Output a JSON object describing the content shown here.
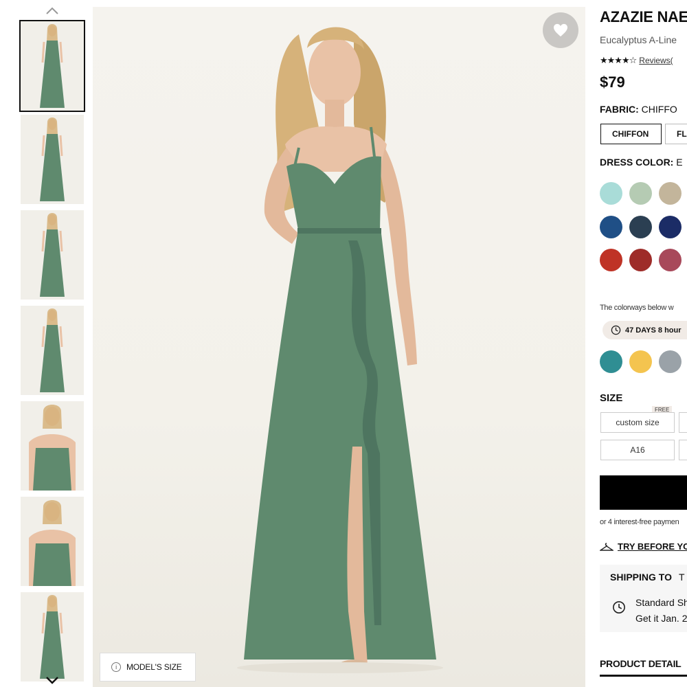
{
  "thumbnails": [
    {
      "view": "front",
      "selected": true
    },
    {
      "view": "back",
      "selected": false
    },
    {
      "view": "front-step",
      "selected": false
    },
    {
      "view": "back-full",
      "selected": false
    },
    {
      "view": "closeup-front",
      "selected": false
    },
    {
      "view": "closeup-back",
      "selected": false
    },
    {
      "view": "front-walk",
      "selected": false
    }
  ],
  "gallery": {
    "prev_icon": "chevron-up-icon",
    "next_icon": "chevron-down-icon",
    "favorite_icon": "heart-icon",
    "model_size_label": "MODEL'S SIZE",
    "model_size_icon": "info-icon"
  },
  "product": {
    "title": "AZAZIE NAE",
    "subtitle": "Eucalyptus A-Line",
    "rating": 4.5,
    "reviews_label": "Reviews(",
    "price": "$79",
    "fabric_label": "FABRIC:",
    "fabric_value": "CHIFFO",
    "fabric_options": [
      "CHIFFON",
      "FL"
    ],
    "color_label": "DRESS COLOR:",
    "color_value": "E",
    "colors_row1": [
      "#a9dcd8",
      "#b5cbb3",
      "#c3b59b"
    ],
    "colors_row2": [
      "#1f4f86",
      "#2b3f52",
      "#1b2c66"
    ],
    "colors_row3": [
      "#bf3326",
      "#9e2c29",
      "#a8495a"
    ],
    "colorways_note": "The colorways below w",
    "timer_text": "47 DAYS 8 hour",
    "timer_icon": "clock-icon",
    "limited_colors": [
      "#2f8e93",
      "#f4c44f",
      "#9aa2a8"
    ],
    "size_label": "SIZE",
    "free_tag": "FREE",
    "sizes": [
      "custom size",
      "",
      "A16",
      ""
    ],
    "payment_note": "or 4 interest-free paymen",
    "try_label": "TRY BEFORE YO",
    "try_icon": "hanger-icon",
    "shipping_label": "SHIPPING TO",
    "shipping_dest": "T",
    "shipping_method": "Standard Sh",
    "shipping_eta": "Get it Jan. 2",
    "shipping_icon": "clock-icon",
    "details_label": "PRODUCT DETAIL"
  },
  "colors": {
    "dress": "#5f8a6e",
    "dress_shadow": "#4e7560",
    "skin": "#e9c2a6",
    "hair": "#d6b27a"
  }
}
